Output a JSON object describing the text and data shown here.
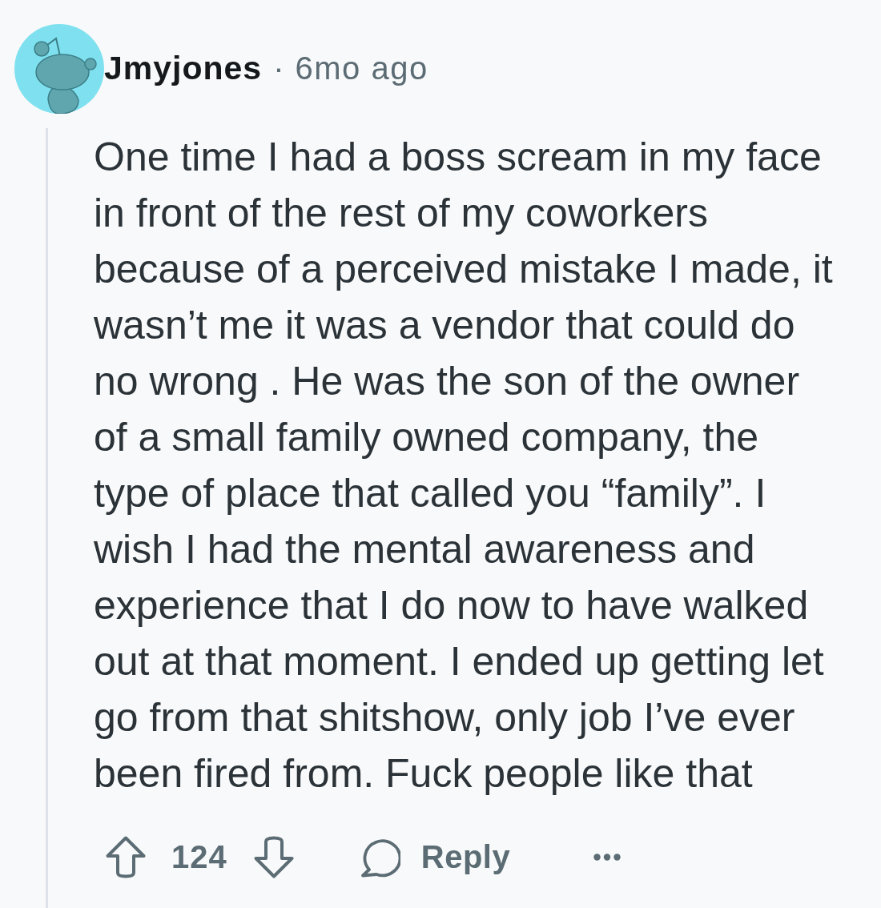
{
  "comment": {
    "author": "Jmyjones",
    "separator": "·",
    "time": "6mo ago",
    "body": "One time I had a boss scream in my face in front of the rest of my coworkers because of a perceived mistake I made, it wasn’t me it was a vendor that could do no wrong . He was the son of the owner of a small family owned company, the type of place that called you “family”. I wish I had the mental awareness and experience that I do now to have walked out at that moment. I ended up getting let go from that shitshow, only job I’ve ever been fired from. Fuck people like that"
  },
  "actions": {
    "score": "124",
    "reply": "Reply"
  }
}
